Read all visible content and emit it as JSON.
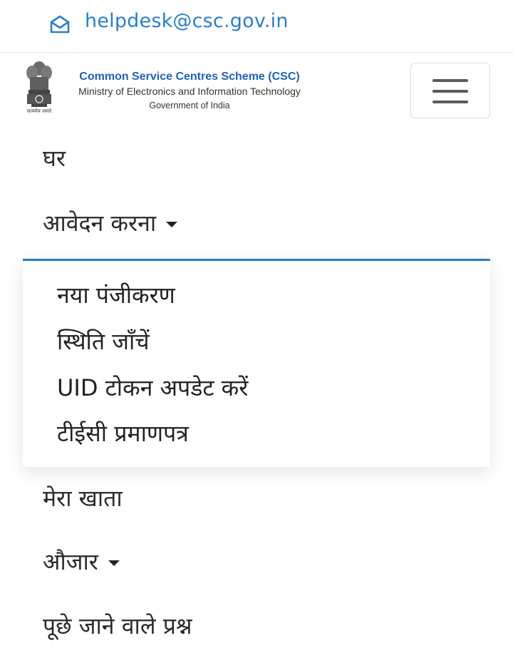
{
  "topbar": {
    "email": "helpdesk@csc.gov.in",
    "mail_icon": "mail-icon"
  },
  "brand": {
    "title": "Common Service Centres Scheme (CSC)",
    "ministry": "Ministry of Electronics and Information Technology",
    "government": "Government of India",
    "emblem_motto": "सत्यमेव जयते",
    "emblem_icon": "national-emblem-icon"
  },
  "menu_toggle": {
    "icon": "hamburger-icon"
  },
  "nav": {
    "home": "घर",
    "apply": "आवेदन करना",
    "apply_dropdown": [
      "नया पंजीकरण",
      "स्थिति जाँचें",
      "UID टोकन अपडेट करें",
      "टीईसी प्रमाणपत्र"
    ],
    "my_account": "मेरा खाता",
    "tools": "औजार",
    "faq": "पूछे जाने वाले प्रश्न"
  },
  "colors": {
    "link_blue": "#2a7fc9",
    "brand_blue": "#1e63b8",
    "dropdown_border": "#1f7ec2"
  }
}
